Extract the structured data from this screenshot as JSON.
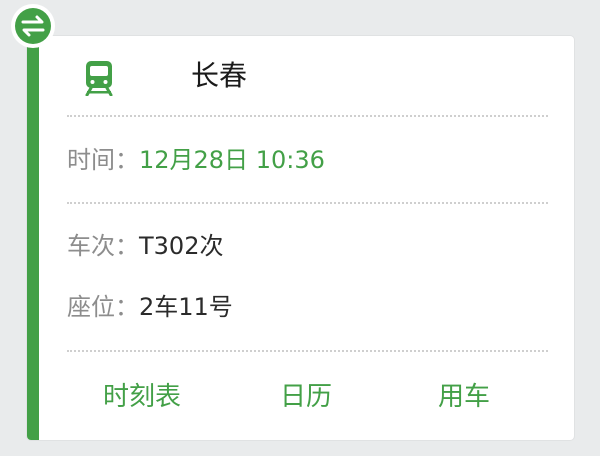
{
  "badge": {
    "icon": "swap-arrows-icon"
  },
  "header": {
    "icon": "train-icon",
    "city": "长春"
  },
  "details": {
    "time_label": "时间：",
    "time_value": "12月28日 10:36",
    "train_label": "车次：",
    "train_value": "T302次",
    "seat_label": "座位：",
    "seat_value": "2车11号"
  },
  "actions": {
    "timetable": "时刻表",
    "calendar": "日历",
    "car": "用车"
  },
  "colors": {
    "accent": "#43a047",
    "label": "#8d8d8d",
    "text": "#2b2b2b"
  }
}
